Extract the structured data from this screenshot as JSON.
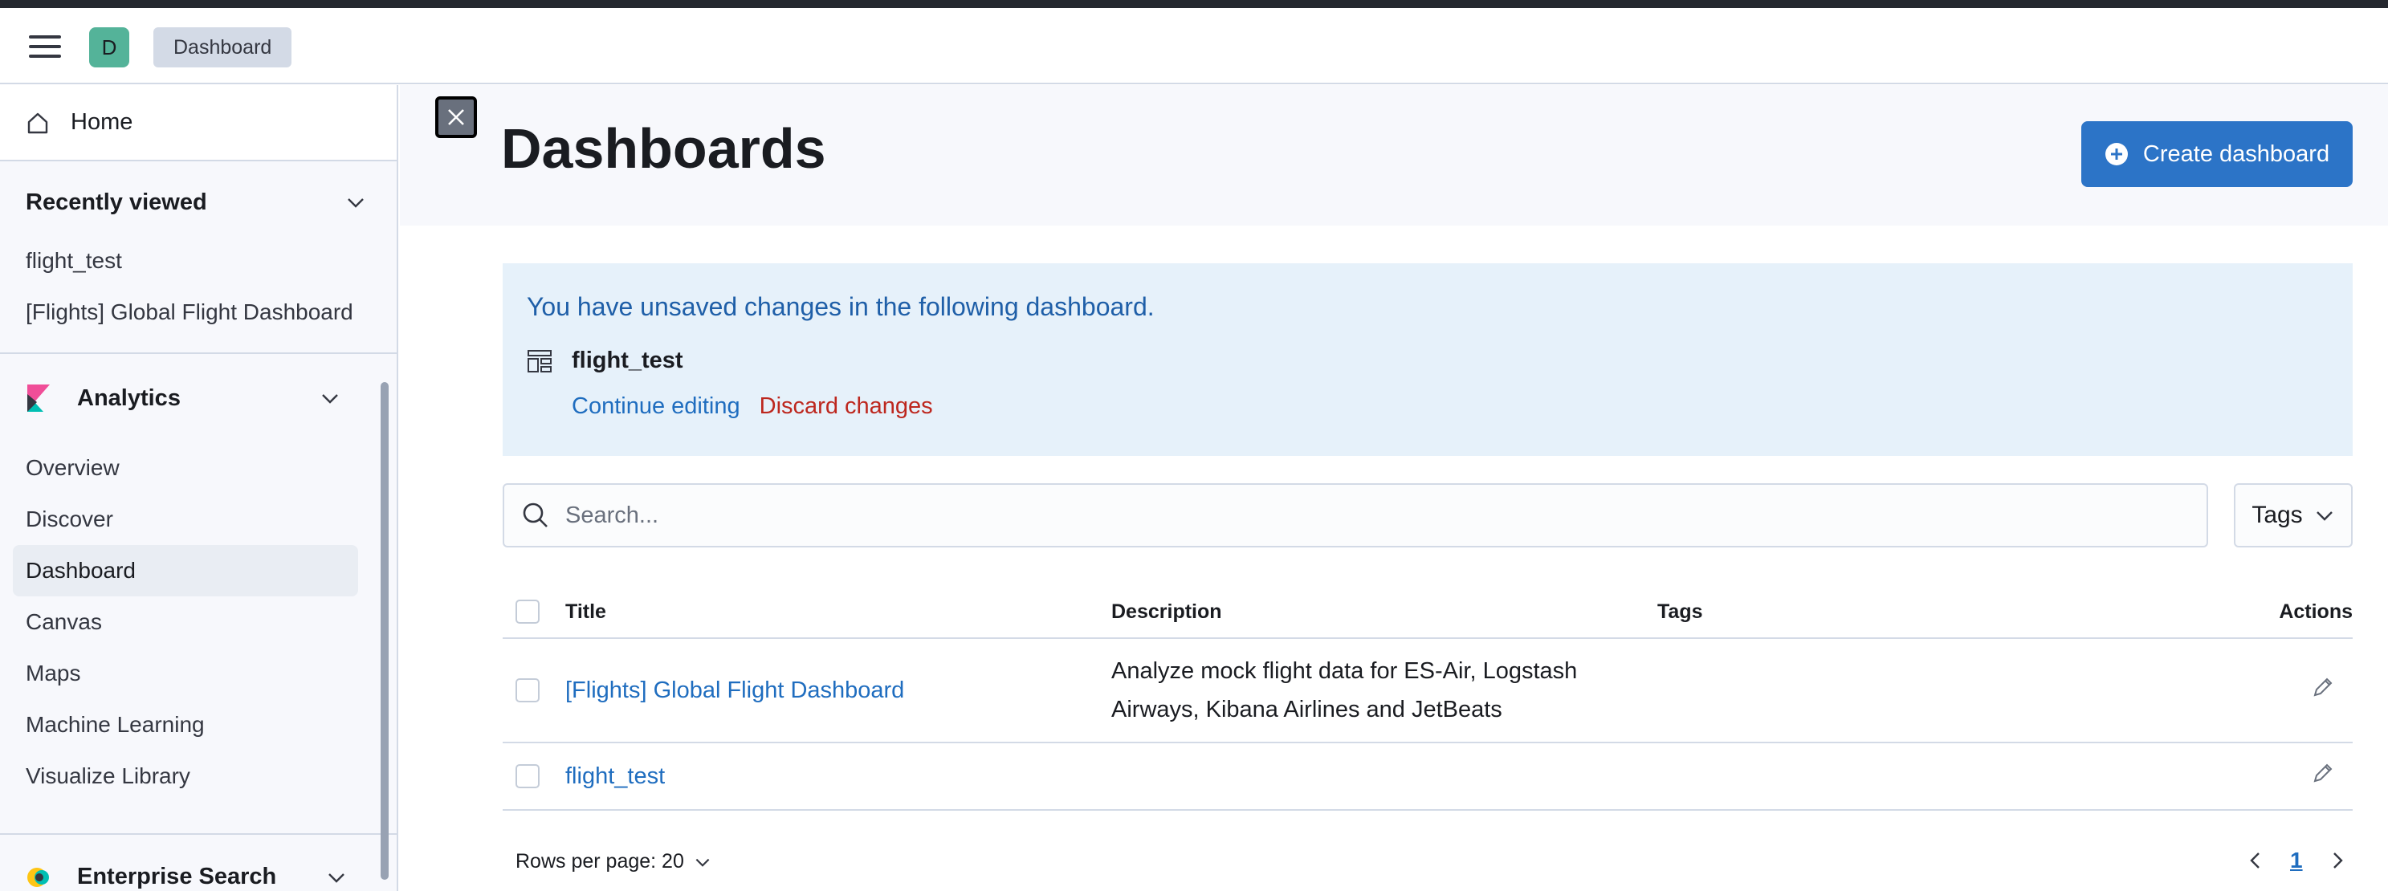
{
  "header": {
    "avatar_initial": "D",
    "breadcrumb": "Dashboard"
  },
  "sidebar": {
    "home_label": "Home",
    "recently_viewed": {
      "title": "Recently viewed",
      "items": [
        "flight_test",
        "[Flights] Global Flight Dashboard"
      ]
    },
    "analytics": {
      "title": "Analytics",
      "items": [
        "Overview",
        "Discover",
        "Dashboard",
        "Canvas",
        "Maps",
        "Machine Learning",
        "Visualize Library"
      ],
      "active": "Dashboard"
    },
    "enterprise_search": {
      "title": "Enterprise Search"
    }
  },
  "main": {
    "title": "Dashboards",
    "create_button": "Create dashboard",
    "callout": {
      "title": "You have unsaved changes in the following dashboard.",
      "dashboard_name": "flight_test",
      "continue_label": "Continue editing",
      "discard_label": "Discard changes"
    },
    "search": {
      "placeholder": "Search..."
    },
    "tags_filter": "Tags",
    "table": {
      "columns": {
        "title": "Title",
        "description": "Description",
        "tags": "Tags",
        "actions": "Actions"
      },
      "rows": [
        {
          "title": "[Flights] Global Flight Dashboard",
          "description_line1": "Analyze mock flight data for ES-Air, Logstash",
          "description_line2": "Airways, Kibana Airlines and JetBeats",
          "tags": ""
        },
        {
          "title": "flight_test",
          "description_line1": "",
          "description_line2": "",
          "tags": ""
        }
      ]
    },
    "pagination": {
      "rows_per_page": "Rows per page: 20",
      "current_page": "1"
    }
  },
  "colors": {
    "accent": "#2c74c7",
    "link": "#1f6dbf",
    "danger": "#bd271e",
    "callout_bg": "#e6f1fa",
    "avatar_bg": "#54b399"
  }
}
